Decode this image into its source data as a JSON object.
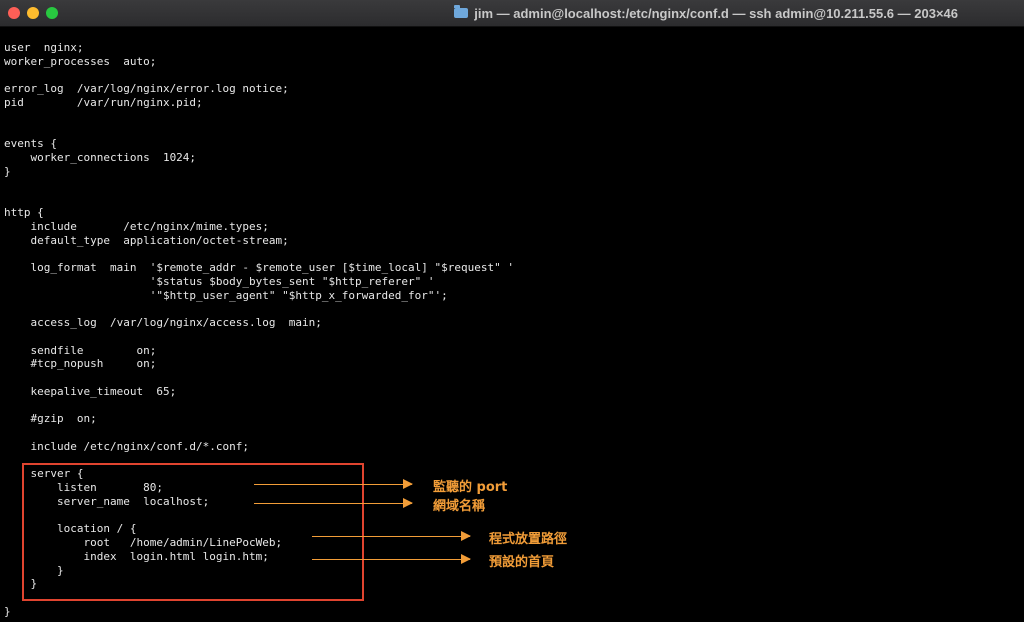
{
  "window": {
    "title": "jim — admin@localhost:/etc/nginx/conf.d — ssh admin@10.211.55.6 — 203×46"
  },
  "terminal": {
    "lines": [
      "user  nginx;",
      "worker_processes  auto;",
      "",
      "error_log  /var/log/nginx/error.log notice;",
      "pid        /var/run/nginx.pid;",
      "",
      "",
      "events {",
      "    worker_connections  1024;",
      "}",
      "",
      "",
      "http {",
      "    include       /etc/nginx/mime.types;",
      "    default_type  application/octet-stream;",
      "",
      "    log_format  main  '$remote_addr - $remote_user [$time_local] \"$request\" '",
      "                      '$status $body_bytes_sent \"$http_referer\" '",
      "                      '\"$http_user_agent\" \"$http_x_forwarded_for\"';",
      "",
      "    access_log  /var/log/nginx/access.log  main;",
      "",
      "    sendfile        on;",
      "    #tcp_nopush     on;",
      "",
      "    keepalive_timeout  65;",
      "",
      "    #gzip  on;",
      "",
      "    include /etc/nginx/conf.d/*.conf;",
      "",
      "    server {",
      "        listen       80;",
      "        server_name  localhost;",
      "",
      "        location / {",
      "            root   /home/admin/LinePocWeb;",
      "            index  login.html login.htm;",
      "        }",
      "    }",
      "",
      "}"
    ]
  },
  "annotations": {
    "port": "監聽的 port",
    "domain": "網域名稱",
    "root": "程式放置路徑",
    "index": "預設的首頁"
  },
  "colors": {
    "box": "#e0442f",
    "annotation": "#f29d38"
  }
}
